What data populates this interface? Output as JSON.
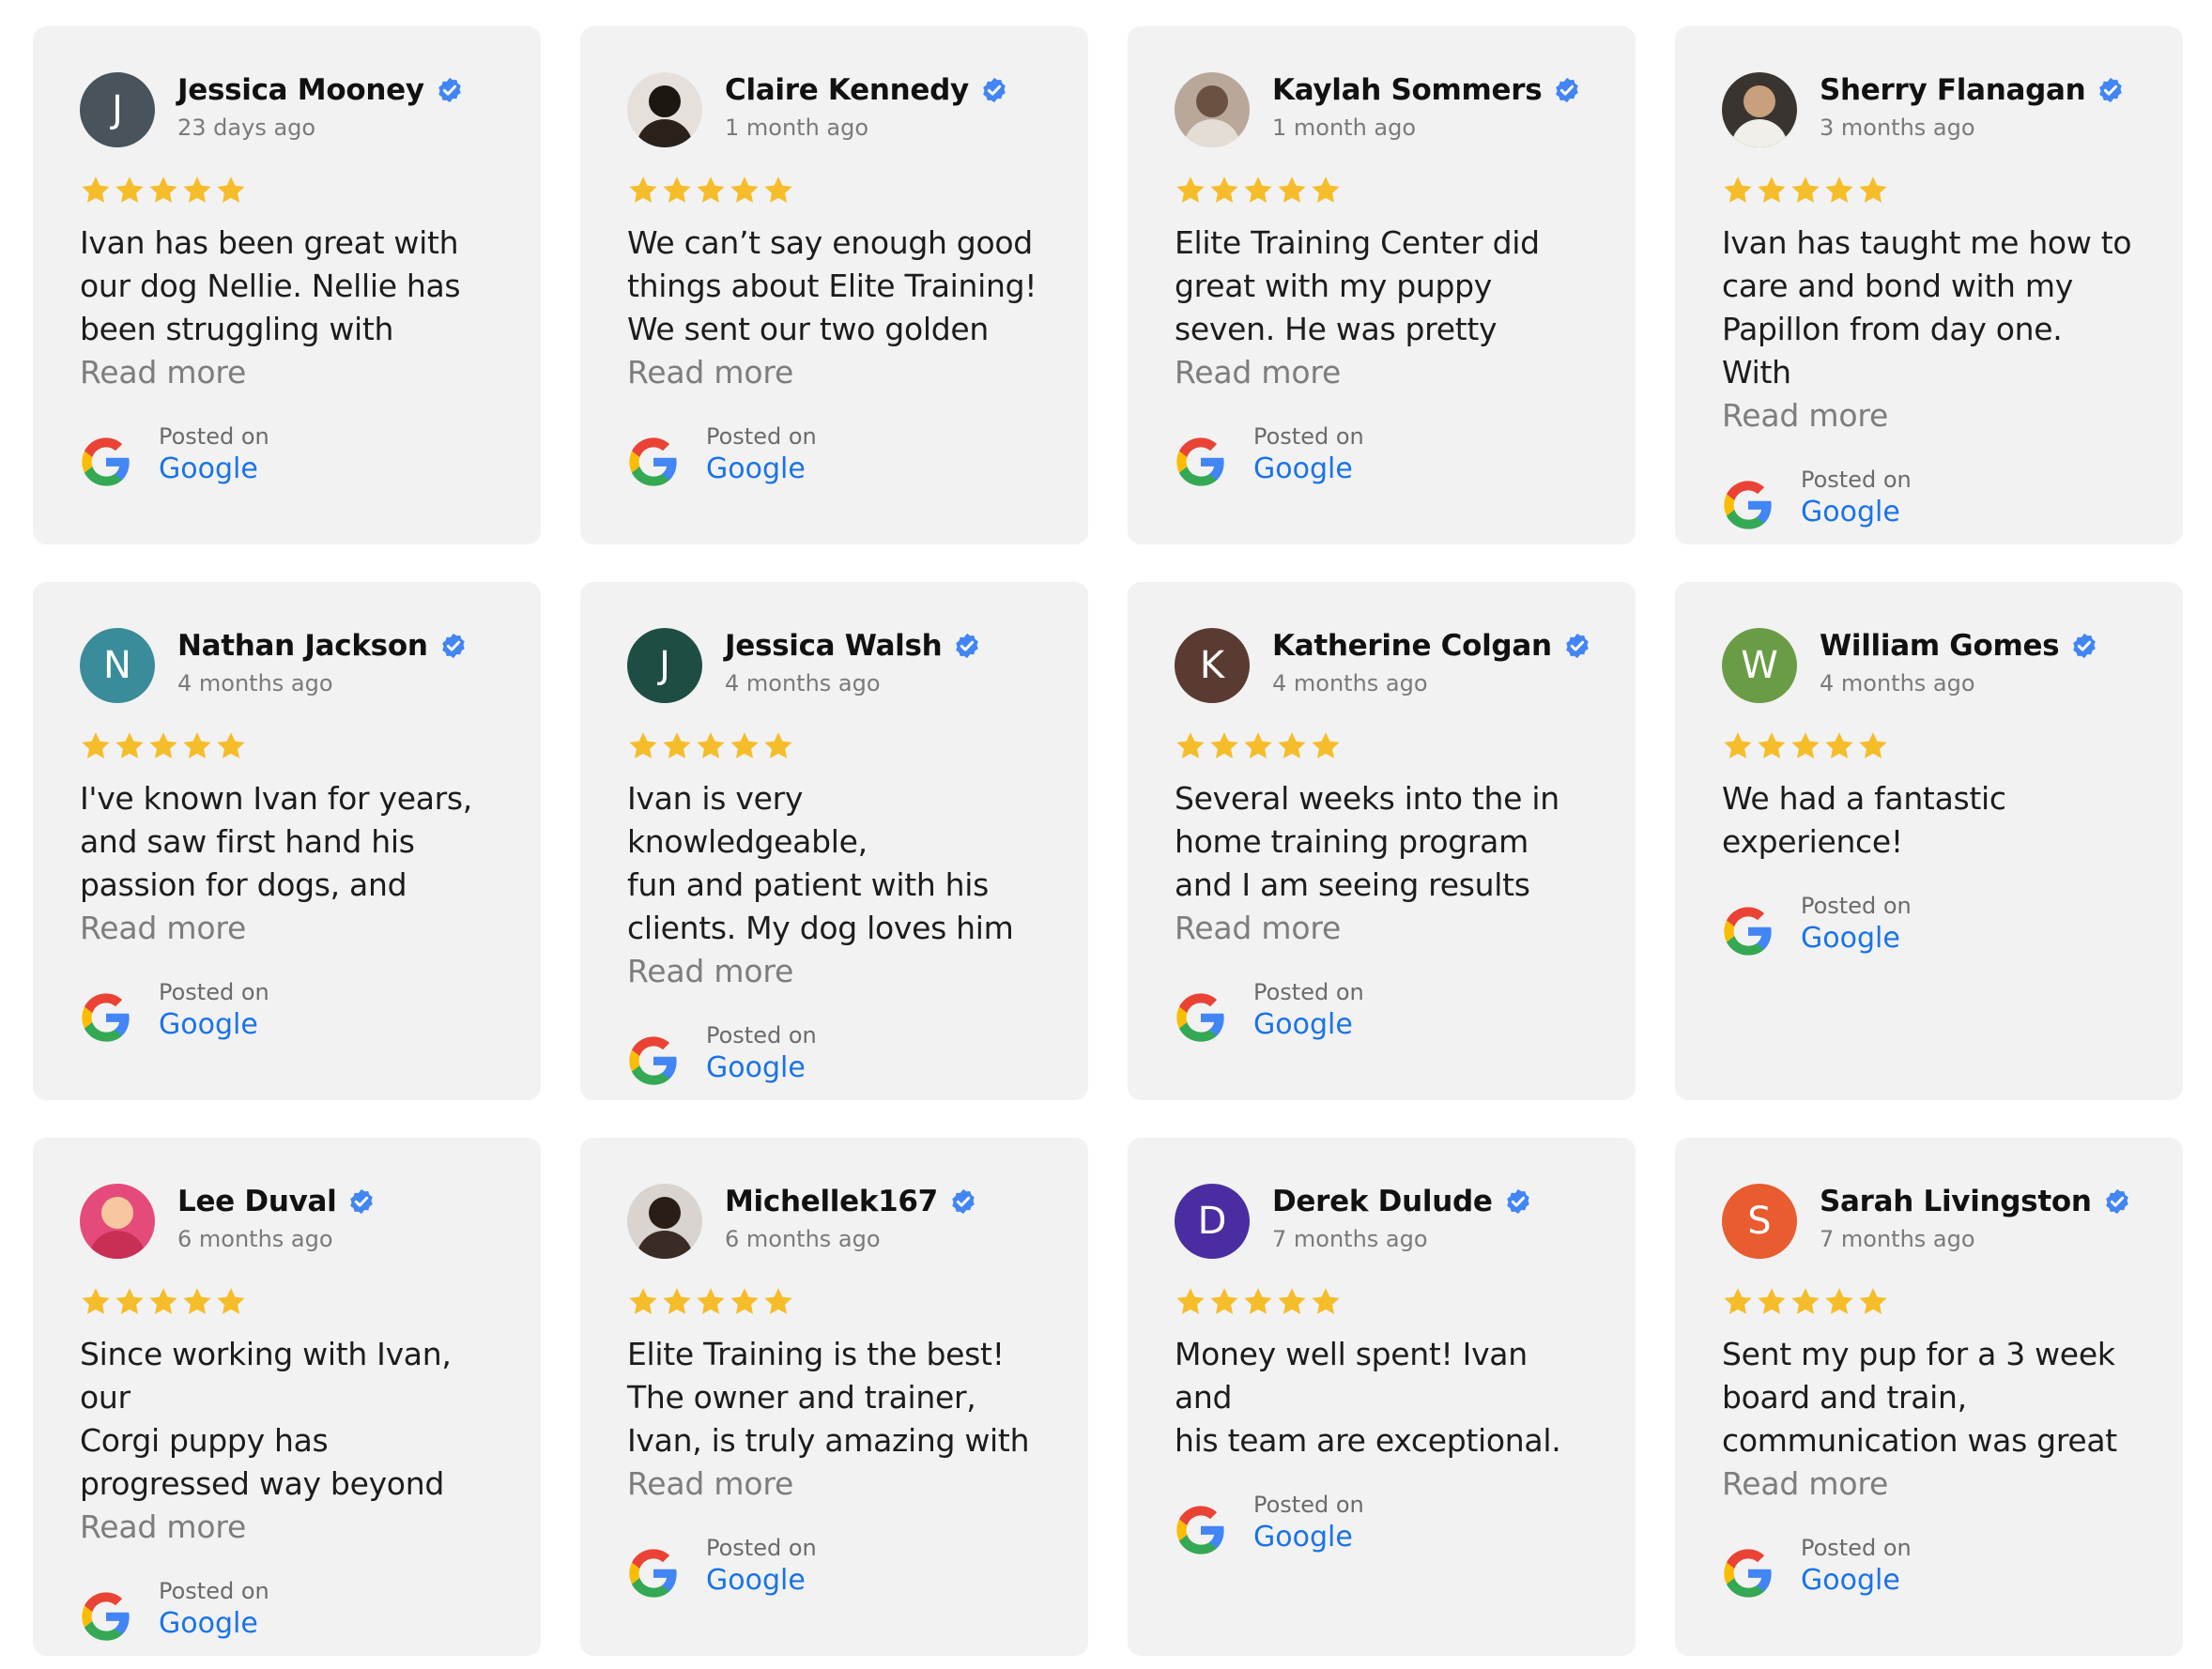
{
  "colors": {
    "star": "#f6bd2b",
    "verified": "#4285f4",
    "link": "#1a73e8",
    "card_bg": "#f2f2f2"
  },
  "reviews": [
    {
      "name": "Jessica Mooney",
      "ago": "23 days ago",
      "avatar": {
        "type": "letter",
        "letter": "J",
        "color": "#48535b"
      },
      "text": "Ivan has been great with\nour dog Nellie. Nellie has\nbeen struggling with",
      "more": "Read more",
      "posted_on": "Posted on",
      "source": "Google",
      "rating": 5
    },
    {
      "name": "Claire Kennedy",
      "ago": "1 month ago",
      "avatar": {
        "type": "photo",
        "bg": "#e6e0dc",
        "head": "#1d1712",
        "body": "#2a211b"
      },
      "text": "We can’t say enough good\nthings about Elite Training!\nWe sent our two golden",
      "more": "Read more",
      "posted_on": "Posted on",
      "source": "Google",
      "rating": 5
    },
    {
      "name": "Kaylah Sommers",
      "ago": "1 month ago",
      "avatar": {
        "type": "photo",
        "bg": "#b9a89a",
        "head": "#6b5142",
        "body": "#e4ddd6"
      },
      "text": "Elite Training Center did\ngreat with my puppy\nseven. He was pretty",
      "more": "Read more",
      "posted_on": "Posted on",
      "source": "Google",
      "rating": 5
    },
    {
      "name": "Sherry Flanagan",
      "ago": "3 months ago",
      "avatar": {
        "type": "photo",
        "bg": "#3a3430",
        "head": "#c8a07d",
        "body": "#f1efe9"
      },
      "text": "Ivan has taught me how to\ncare and bond with my\nPapillon from day one. With",
      "more": "Read more",
      "posted_on": "Posted on",
      "source": "Google",
      "rating": 5
    },
    {
      "name": "Nathan Jackson",
      "ago": "4 months ago",
      "avatar": {
        "type": "letter",
        "letter": "N",
        "color": "#3a8c9a"
      },
      "text": "I've known Ivan for years,\nand saw first hand his\npassion for dogs, and",
      "more": "Read more",
      "posted_on": "Posted on",
      "source": "Google",
      "rating": 5
    },
    {
      "name": "Jessica Walsh",
      "ago": "4 months ago",
      "avatar": {
        "type": "letter",
        "letter": "J",
        "color": "#1e4d43"
      },
      "text": "Ivan is very knowledgeable,\nfun and patient with his\nclients. My dog loves him",
      "more": "Read more",
      "posted_on": "Posted on",
      "source": "Google",
      "rating": 5
    },
    {
      "name": "Katherine Colgan",
      "ago": "4 months ago",
      "avatar": {
        "type": "letter",
        "letter": "K",
        "color": "#5a3b32"
      },
      "text": "Several weeks into the in\nhome training program\nand I am seeing results",
      "more": "Read more",
      "posted_on": "Posted on",
      "source": "Google",
      "rating": 5
    },
    {
      "name": "William Gomes",
      "ago": "4 months ago",
      "avatar": {
        "type": "letter",
        "letter": "W",
        "color": "#6a9c46"
      },
      "text": "We had a fantastic\nexperience!",
      "more": "",
      "posted_on": "Posted on",
      "source": "Google",
      "rating": 5
    },
    {
      "name": "Lee Duval",
      "ago": "6 months ago",
      "avatar": {
        "type": "photo",
        "bg": "#e54b7a",
        "head": "#f7c7a0",
        "body": "#c92f55"
      },
      "text": "Since working with Ivan, our\nCorgi puppy has\nprogressed way beyond",
      "more": "Read more",
      "posted_on": "Posted on",
      "source": "Google",
      "rating": 5
    },
    {
      "name": "Michellek167",
      "ago": "6 months ago",
      "avatar": {
        "type": "photo",
        "bg": "#d9d4d0",
        "head": "#2a1d16",
        "body": "#3a2c24"
      },
      "text": "Elite Training is the best!\nThe owner and trainer,\nIvan, is truly amazing with",
      "more": "Read more",
      "posted_on": "Posted on",
      "source": "Google",
      "rating": 5
    },
    {
      "name": "Derek Dulude",
      "ago": "7 months ago",
      "avatar": {
        "type": "letter",
        "letter": "D",
        "color": "#4a2da0"
      },
      "text": "Money well spent! Ivan and\nhis team are exceptional.",
      "more": "",
      "posted_on": "Posted on",
      "source": "Google",
      "rating": 5
    },
    {
      "name": "Sarah Livingston",
      "ago": "7 months ago",
      "avatar": {
        "type": "letter",
        "letter": "S",
        "color": "#e85c30"
      },
      "text": "Sent my pup for a 3 week\nboard and train,\ncommunication was great",
      "more": "Read more",
      "posted_on": "Posted on",
      "source": "Google",
      "rating": 5
    }
  ]
}
